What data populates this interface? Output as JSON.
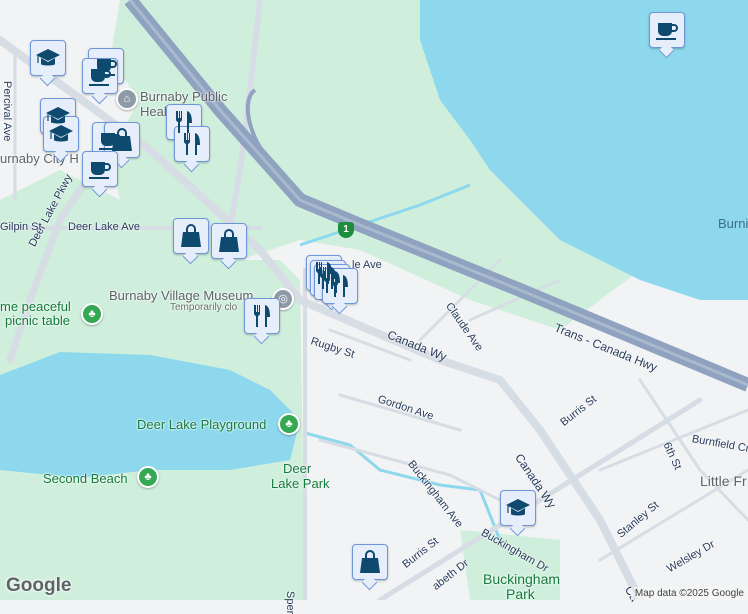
{
  "map": {
    "streets": {
      "percival": "Percival Ave",
      "deer_lake_pkwy": "Deer Lake Pkwy",
      "gilpin": "Gilpin St",
      "deer_lake_ave": "Deer Lake Ave",
      "avenue_partial": "le Ave",
      "claude": "Claude Ave",
      "canada_wy_1": "Canada Wy",
      "canada_wy_2": "Canada Wy",
      "canada_wy_3": "Ca",
      "rugby": "Rugby St",
      "gordon": "Gordon Ave",
      "buckingham_ave": "Buckingham Ave",
      "buckingham_dr": "Buckingham Dr",
      "burris_1": "Burris St",
      "burris_2": "Burris St",
      "trans_canada": "Trans - Canada Hwy",
      "sixth": "6th St",
      "burnfield": "Burnfield Cr",
      "stanley": "Stanley St",
      "welsley": "Welsley Dr",
      "elizabeth": "abeth Dr",
      "sperling": "Sper"
    },
    "places": {
      "library": "Burnaby Public",
      "library_2": "Heal",
      "city_hall": "urnaby City H",
      "museum": "Burnaby Village Museum",
      "museum_status": "Temporarily clo",
      "picnic_1": "me peaceful",
      "picnic_2": "picnic table",
      "playground": "Deer Lake Playground",
      "deer_lake_park_1": "Deer",
      "deer_lake_park_2": "Lake Park",
      "second_beach": "Second Beach",
      "buckingham_park_1": "Buckingham",
      "buckingham_park_2": "Park",
      "little_fr": "Little Fr",
      "burnaby_lake": "Burni"
    },
    "highway_shield": "1",
    "markers": [
      {
        "type": "coffee-icon"
      },
      {
        "type": "graduation-cap-icon"
      },
      {
        "type": "coffee-icon"
      },
      {
        "type": "coffee-icon"
      },
      {
        "type": "graduation-cap-icon"
      },
      {
        "type": "graduation-cap-icon"
      },
      {
        "type": "coffee-icon"
      },
      {
        "type": "shopping-bag-icon"
      },
      {
        "type": "restaurant-icon"
      },
      {
        "type": "restaurant-icon"
      },
      {
        "type": "coffee-icon"
      },
      {
        "type": "shopping-bag-icon"
      },
      {
        "type": "shopping-bag-icon"
      },
      {
        "type": "restaurant-icon"
      },
      {
        "type": "restaurant-icon"
      },
      {
        "type": "restaurant-icon"
      },
      {
        "type": "restaurant-icon"
      },
      {
        "type": "restaurant-icon"
      },
      {
        "type": "graduation-cap-icon"
      },
      {
        "type": "shopping-bag-icon"
      }
    ],
    "colors": {
      "park": "#cfefdc",
      "water": "#8ed8ee",
      "highway": "#8fa3c0",
      "road": "#d6dde4",
      "marker": "#0e4a6e"
    }
  },
  "footer": {
    "logo": "Google",
    "attribution": "Map data ©2025 Google"
  }
}
